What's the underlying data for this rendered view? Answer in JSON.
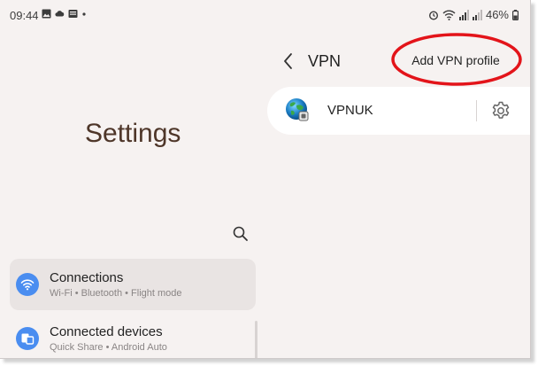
{
  "status_bar": {
    "time": "09:44",
    "left_icons": [
      "image-icon",
      "cloud-icon",
      "news-icon",
      "dot-icon"
    ],
    "right_icons": [
      "alarm-icon",
      "wifi-icon",
      "signal-icon",
      "signal-icon",
      "battery-icon"
    ],
    "battery": "46%"
  },
  "left_pane": {
    "title": "Settings",
    "search_icon": "search-icon",
    "items": [
      {
        "title": "Connections",
        "subtitle": "Wi-Fi  •  Bluetooth  •  Flight mode",
        "icon": "wifi-icon"
      },
      {
        "title": "Connected devices",
        "subtitle": "Quick Share  •  Android Auto",
        "icon": "devices-icon"
      }
    ]
  },
  "right_pane": {
    "title": "VPN",
    "add_profile_label": "Add VPN profile",
    "profiles": [
      {
        "name": "VPNUK",
        "icon": "globe-icon",
        "settings_icon": "gear-icon"
      }
    ]
  },
  "colors": {
    "background": "#f6f2f1",
    "accent_blue": "#4a8df0",
    "highlight_red": "#e3141a",
    "title_brown": "#4e3629"
  }
}
